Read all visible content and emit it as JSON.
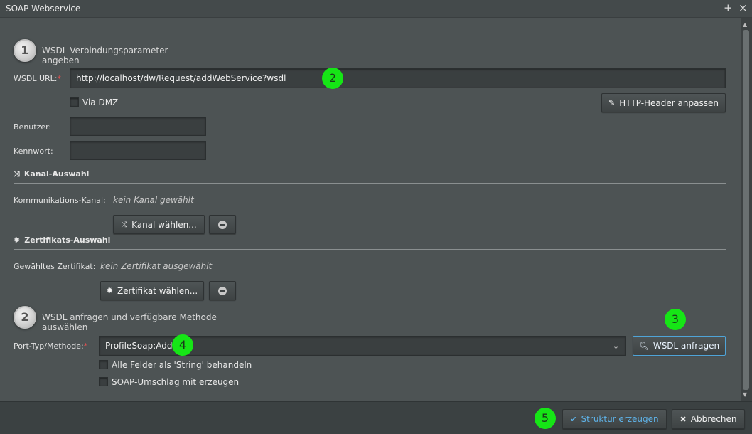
{
  "window": {
    "title": "SOAP Webservice",
    "add_glyph": "+",
    "close_glyph": "×"
  },
  "step1": {
    "number": "1",
    "title": "WSDL Verbindungsparameter angeben"
  },
  "wsdl_url": {
    "label": "WSDL URL:",
    "required": "*",
    "value": "http://localhost/dw/Request/addWebService?wsdl"
  },
  "via_dmz": {
    "label": "Via DMZ",
    "checked": false
  },
  "http_header_button": {
    "label": "HTTP-Header anpassen",
    "icon": "pencil-icon"
  },
  "benutzer": {
    "label": "Benutzer:",
    "value": ""
  },
  "kennwort": {
    "label": "Kennwort:",
    "value": ""
  },
  "kanal_section": {
    "title": "Kanal-Auswahl",
    "icon": "shuffle-icon"
  },
  "kommunikations_kanal": {
    "label": "Kommunikations-Kanal:",
    "value": "kein Kanal gewählt"
  },
  "kanal_button": {
    "label": "Kanal wählen..."
  },
  "zertifikat_section": {
    "title": "Zertifikats-Auswahl",
    "icon": "gear-icon"
  },
  "gewaehltes_zertifikat": {
    "label": "Gewähltes Zertifikat:",
    "value": "kein Zertifikat ausgewählt"
  },
  "zertifikat_button": {
    "label": "Zertifikat wählen..."
  },
  "step2": {
    "number": "2",
    "title": "WSDL anfragen und verfügbare Methode auswählen"
  },
  "port_typ": {
    "label": "Port-Typ/Methode:",
    "required": "*",
    "value": "ProfileSoap:Add"
  },
  "wsdl_anfragen_button": {
    "label": "WSDL anfragen",
    "icon": "search-icon"
  },
  "alle_felder_string": {
    "label": "Alle Felder als 'String' behandeln",
    "checked": false
  },
  "soap_umschlag": {
    "label": "SOAP-Umschlag mit erzeugen",
    "checked": false
  },
  "footer": {
    "struktur_button": {
      "label": "Struktur erzeugen",
      "icon": "check-icon"
    },
    "abbrechen_button": {
      "label": "Abbrechen",
      "icon": "close-icon"
    }
  },
  "markers": [
    "2",
    "3",
    "4",
    "5"
  ],
  "colors": {
    "marker": "#16e516",
    "accent": "#4fa4d8",
    "required": "#e05050"
  }
}
